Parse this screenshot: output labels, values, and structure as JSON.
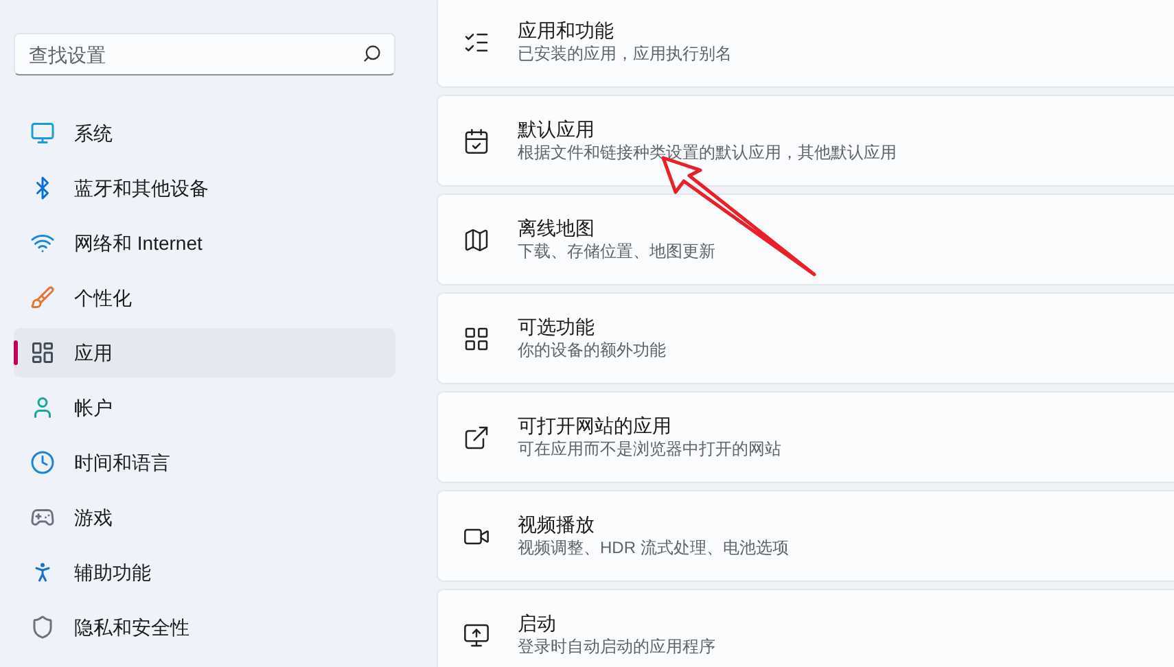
{
  "search": {
    "placeholder": "查找设置"
  },
  "sidebar": {
    "items": [
      {
        "label": "系统",
        "selected": false
      },
      {
        "label": "蓝牙和其他设备",
        "selected": false
      },
      {
        "label": "网络和 Internet",
        "selected": false
      },
      {
        "label": "个性化",
        "selected": false
      },
      {
        "label": "应用",
        "selected": true
      },
      {
        "label": "帐户",
        "selected": false
      },
      {
        "label": "时间和语言",
        "selected": false
      },
      {
        "label": "游戏",
        "selected": false
      },
      {
        "label": "辅助功能",
        "selected": false
      },
      {
        "label": "隐私和安全性",
        "selected": false
      }
    ]
  },
  "cards": [
    {
      "title": "应用和功能",
      "subtitle": "已安装的应用，应用执行别名"
    },
    {
      "title": "默认应用",
      "subtitle": "根据文件和链接种类设置的默认应用，其他默认应用"
    },
    {
      "title": "离线地图",
      "subtitle": "下载、存储位置、地图更新"
    },
    {
      "title": "可选功能",
      "subtitle": "你的设备的额外功能"
    },
    {
      "title": "可打开网站的应用",
      "subtitle": "可在应用而不是浏览器中打开的网站"
    },
    {
      "title": "视频播放",
      "subtitle": "视频调整、HDR 流式处理、电池选项"
    },
    {
      "title": "启动",
      "subtitle": "登录时自动启动的应用程序"
    }
  ]
}
